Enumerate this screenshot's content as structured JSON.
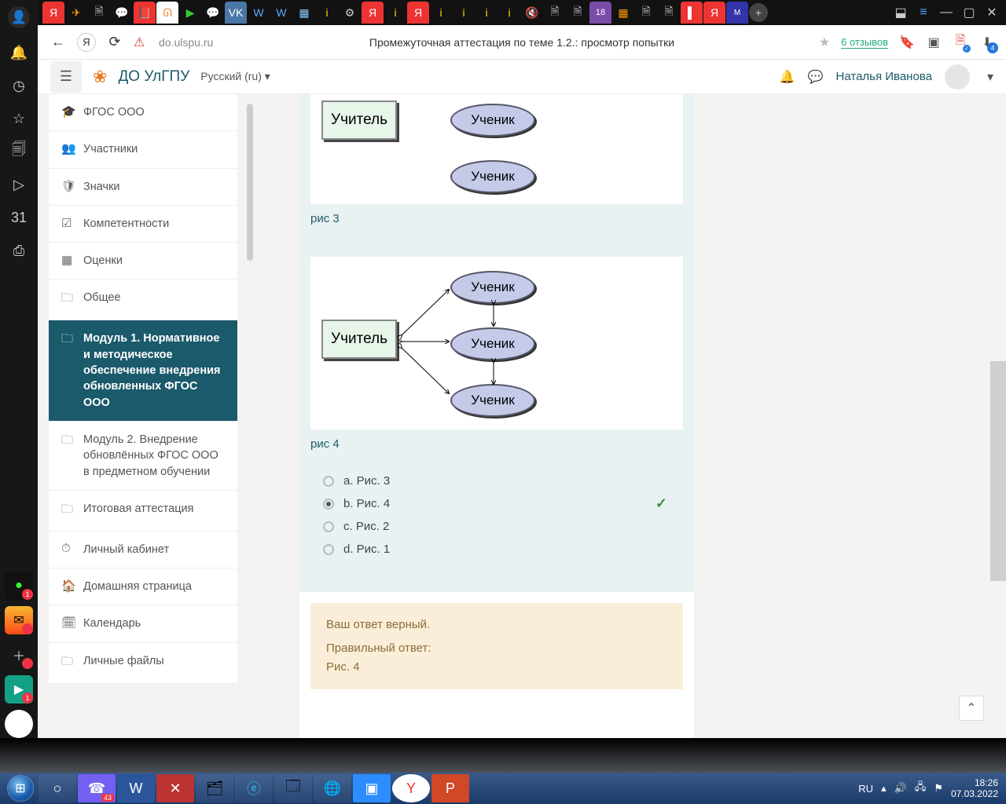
{
  "browser": {
    "url": "do.ulspu.ru",
    "page_title": "Промежуточная аттестация по теме 1.2.: просмотр попытки",
    "reviews": "6 отзывов",
    "download_badge": "4"
  },
  "moodle": {
    "brand": "ДО УлГПУ",
    "language": "Русский (ru)",
    "username": "Наталья Иванова"
  },
  "course_nav": [
    {
      "icon": "🎓",
      "label": "ФГОС ООО"
    },
    {
      "icon": "👥",
      "label": "Участники"
    },
    {
      "icon": "🛡",
      "label": "Значки"
    },
    {
      "icon": "☑",
      "label": "Компетентности"
    },
    {
      "icon": "▦",
      "label": "Оценки"
    },
    {
      "icon": "🗀",
      "label": "Общее"
    },
    {
      "icon": "🗀",
      "label": "Модуль 1. Нормативное и методическое обеспечение внедрения обновленных ФГОС ООО",
      "active": true
    },
    {
      "icon": "🗀",
      "label": "Модуль 2. Внедрение обновлённых ФГОС ООО в предметном обучении"
    },
    {
      "icon": "🗀",
      "label": "Итоговая аттестация"
    },
    {
      "icon": "⏱",
      "label": "Личный кабинет"
    },
    {
      "icon": "🏠",
      "label": "Домашняя страница"
    },
    {
      "icon": "🗓",
      "label": "Календарь"
    },
    {
      "icon": "🗀",
      "label": "Личные файлы"
    }
  ],
  "diagram": {
    "teacher": "Учитель",
    "student": "Ученик",
    "caption3": "рис 3",
    "caption4": "рис 4"
  },
  "answers": [
    {
      "key": "a",
      "label": "a. Рис. 3",
      "selected": false,
      "correct": false
    },
    {
      "key": "b",
      "label": "b. Рис. 4",
      "selected": true,
      "correct": true
    },
    {
      "key": "c",
      "label": "c. Рис. 2",
      "selected": false,
      "correct": false
    },
    {
      "key": "d",
      "label": "d. Рис. 1",
      "selected": false,
      "correct": false
    }
  ],
  "feedback": {
    "line1": "Ваш ответ верный.",
    "line2": "Правильный ответ:",
    "line3": "Рис. 4"
  },
  "tray": {
    "lang": "RU",
    "time": "18:26",
    "date": "07.03.2022"
  },
  "viber_badge": "43",
  "sidebar_badge": "1"
}
